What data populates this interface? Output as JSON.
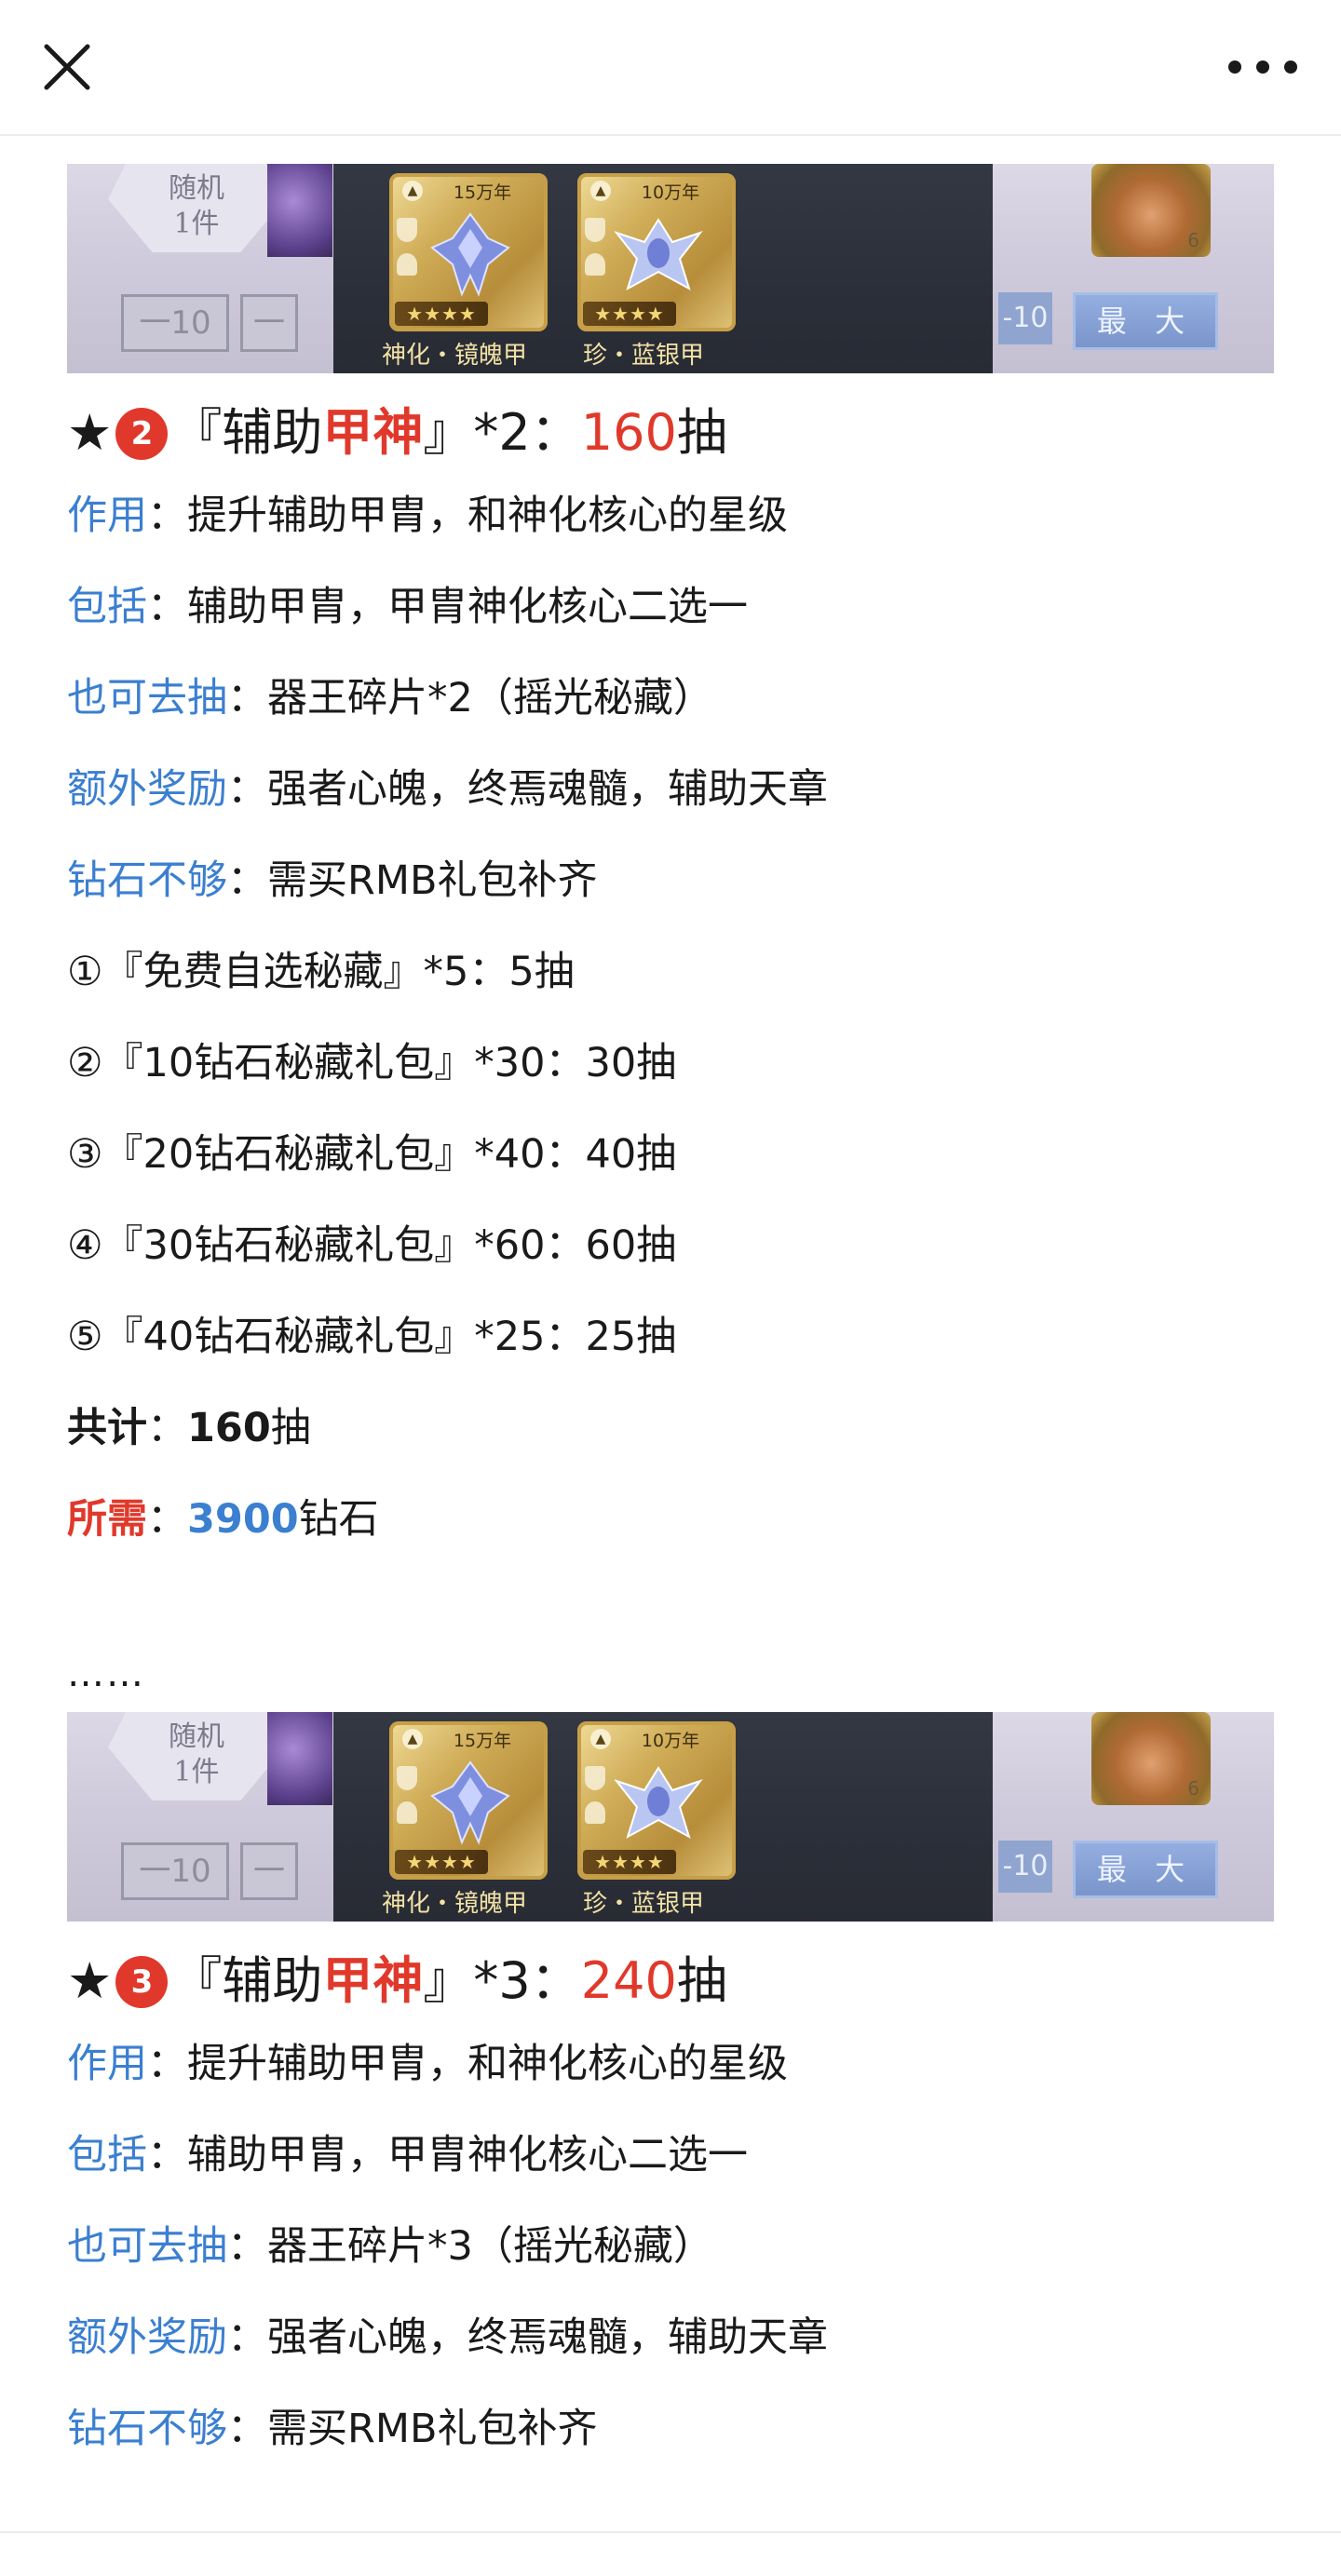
{
  "topbar": {
    "close_icon": "close-icon",
    "more_icon": "more-icon"
  },
  "banner": {
    "left_badge": "随机\n1件",
    "minus10": "一10",
    "minus": "一",
    "right_minus10": "-10",
    "max": "最 大",
    "right_count": "6",
    "cards": [
      {
        "years": "15万年",
        "stars": "★★★★"
      },
      {
        "years": "10万年",
        "stars": "★★★★"
      }
    ],
    "captions": [
      "神化・镜魄甲",
      "珍・蓝银甲"
    ]
  },
  "sections": [
    {
      "star": "★",
      "number": "2",
      "title_pre": "『辅助",
      "title_red": "甲神",
      "title_post": "』*2：",
      "pulls": "160",
      "pulls_unit": "抽",
      "effect_label": "作用",
      "effect": "：提升辅助甲胄，和神化核心的星级",
      "include_label": "包括",
      "include": "：辅助甲胄，甲胄神化核心二选一",
      "alt_label": "也可去抽",
      "alt": "：器王碎片*2（摇光秘藏）",
      "bonus_label": "额外奖励",
      "bonus": "：强者心魄，终焉魂髓，辅助天章",
      "lack_label": "钻石不够",
      "lack": "：需买RMB礼包补齐",
      "items": [
        "①『免费自选秘藏』*5：5抽",
        "②『10钻石秘藏礼包』*30：30抽",
        "③『20钻石秘藏礼包』*40：40抽",
        "④『30钻石秘藏礼包』*60：60抽",
        "⑤『40钻石秘藏礼包』*25：25抽"
      ],
      "total_label": "共计",
      "total_sep": "：",
      "total_value": "160",
      "total_unit": "抽",
      "need_label": "所需",
      "need_sep": "：",
      "need_value": "3900",
      "need_unit": "钻石"
    },
    {
      "star": "★",
      "number": "3",
      "title_pre": "『辅助",
      "title_red": "甲神",
      "title_post": "』*3：",
      "pulls": "240",
      "pulls_unit": "抽",
      "effect_label": "作用",
      "effect": "：提升辅助甲胄，和神化核心的星级",
      "include_label": "包括",
      "include": "：辅助甲胄，甲胄神化核心二选一",
      "alt_label": "也可去抽",
      "alt": "：器王碎片*3（摇光秘藏）",
      "bonus_label": "额外奖励",
      "bonus": "：强者心魄，终焉魂髓，辅助天章",
      "lack_label": "钻石不够",
      "lack": "：需买RMB礼包补齐"
    }
  ],
  "ellipsis": "……",
  "colors": {
    "red": "#e0392b",
    "blue": "#3b7fd0",
    "gold": "#d0ad58"
  }
}
